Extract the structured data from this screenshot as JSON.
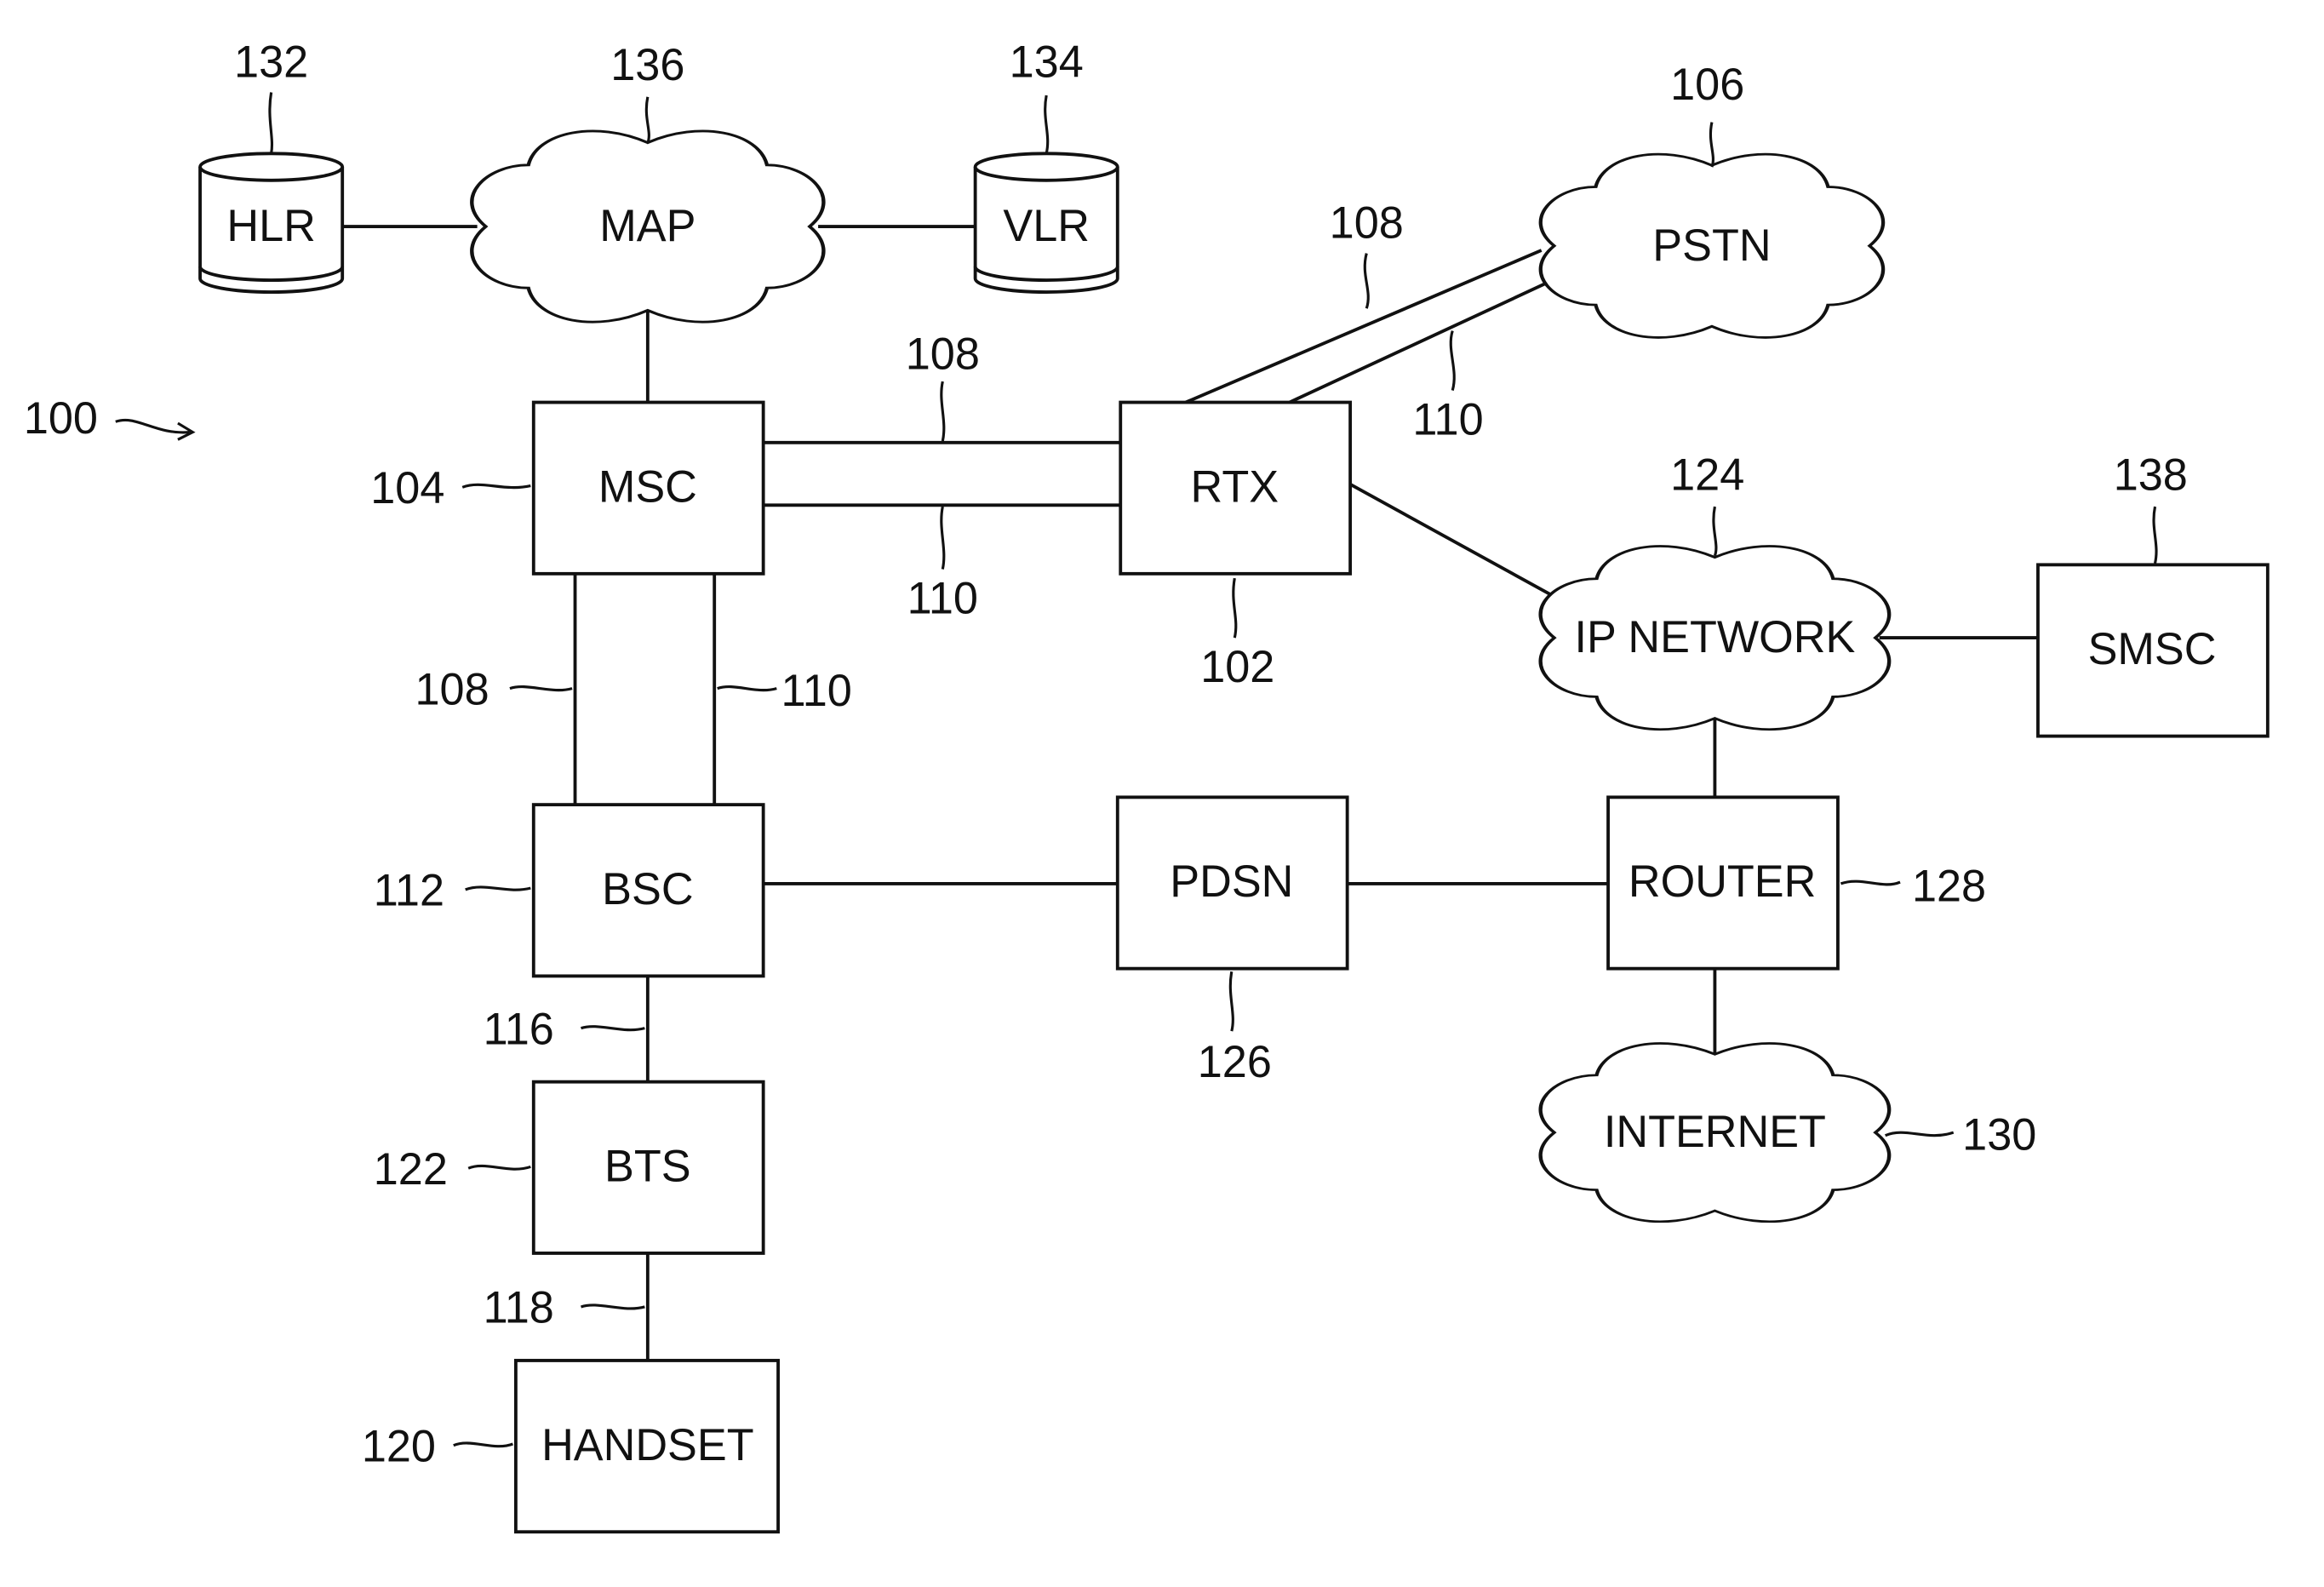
{
  "figure_ref": "100",
  "nodes": {
    "hlr": {
      "label": "HLR",
      "ref": "132"
    },
    "map": {
      "label": "MAP",
      "ref": "136"
    },
    "vlr": {
      "label": "VLR",
      "ref": "134"
    },
    "pstn": {
      "label": "PSTN",
      "ref": "106"
    },
    "msc": {
      "label": "MSC",
      "ref": "104"
    },
    "rtx": {
      "label": "RTX",
      "ref": "102"
    },
    "ipnet": {
      "label": "IP NETWORK",
      "ref": "124"
    },
    "smsc": {
      "label": "SMSC",
      "ref": "138"
    },
    "bsc": {
      "label": "BSC",
      "ref": "112"
    },
    "pdsn": {
      "label": "PDSN",
      "ref": "126"
    },
    "router": {
      "label": "ROUTER",
      "ref": "128"
    },
    "internet": {
      "label": "INTERNET",
      "ref": "130"
    },
    "bts": {
      "label": "BTS",
      "ref": "122"
    },
    "handset": {
      "label": "HANDSET",
      "ref": "120"
    }
  },
  "links": {
    "l108": "108",
    "l110": "110",
    "l116": "116",
    "l118": "118"
  }
}
